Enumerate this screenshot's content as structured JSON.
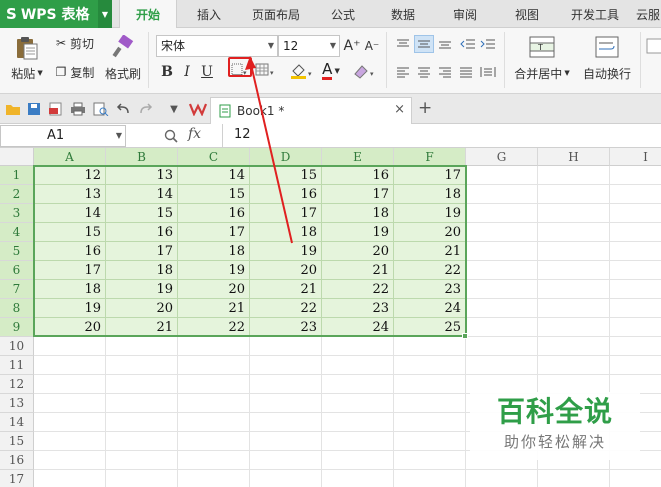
{
  "app": {
    "name": "WPS 表格",
    "logo": "S"
  },
  "menu_tabs": [
    "开始",
    "插入",
    "页面布局",
    "公式",
    "数据",
    "审阅",
    "视图",
    "开发工具",
    "云服"
  ],
  "active_tab": "开始",
  "ribbon": {
    "paste": "粘贴",
    "cut": "剪切",
    "copy": "复制",
    "format_painter": "格式刷",
    "font_name": "宋体",
    "font_size": "12",
    "bold": "B",
    "italic": "I",
    "underline": "U",
    "font_color_glyph": "A",
    "grow_font": "A⁺",
    "shrink_font": "A⁻",
    "merge_center": "合并居中",
    "wrap_text": "自动换行"
  },
  "doc_tab": {
    "name": "Book1 *",
    "close": "×",
    "add": "+"
  },
  "formula_bar": {
    "name_box": "A1",
    "fx": "fx",
    "value": "12"
  },
  "sheet": {
    "columns": [
      "A",
      "B",
      "C",
      "D",
      "E",
      "F",
      "G",
      "H",
      "I"
    ],
    "rows": [
      "1",
      "2",
      "3",
      "4",
      "5",
      "6",
      "7",
      "8",
      "9",
      "10",
      "11",
      "12",
      "13",
      "14",
      "15",
      "16",
      "17"
    ],
    "selected_columns": 6,
    "selected_rows": 9,
    "cells": [
      [
        "12",
        "13",
        "14",
        "15",
        "16",
        "17"
      ],
      [
        "13",
        "14",
        "15",
        "16",
        "17",
        "18"
      ],
      [
        "14",
        "15",
        "16",
        "17",
        "18",
        "19"
      ],
      [
        "15",
        "16",
        "17",
        "18",
        "19",
        "20"
      ],
      [
        "16",
        "17",
        "18",
        "19",
        "20",
        "21"
      ],
      [
        "17",
        "18",
        "19",
        "20",
        "21",
        "22"
      ],
      [
        "18",
        "19",
        "20",
        "21",
        "22",
        "23"
      ],
      [
        "19",
        "20",
        "21",
        "22",
        "23",
        "24"
      ],
      [
        "20",
        "21",
        "22",
        "23",
        "24",
        "25"
      ]
    ]
  },
  "watermark": {
    "title": "百科全说",
    "subtitle": "助你轻松解决"
  },
  "colors": {
    "brand": "#2f9e48",
    "selection_fill": "#e5f4dc",
    "selection_border": "#5aa55a",
    "annotation": "#e02020"
  }
}
